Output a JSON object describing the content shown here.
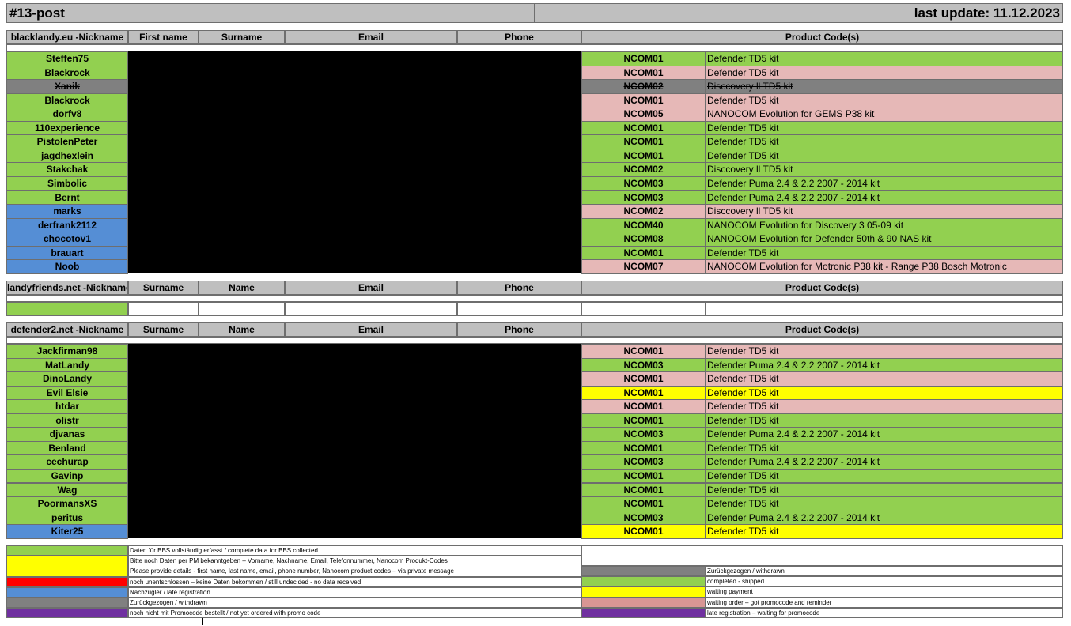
{
  "title_left": "#13-post",
  "title_right": "last update: 11.12.2023",
  "colors": {
    "green": "#92d050",
    "pink": "#e6b8b7",
    "gray": "#808080",
    "blue": "#558ed5",
    "yellow": "#ffff00",
    "red": "#ff0000",
    "purple": "#7030a0",
    "rose": "#d99694",
    "header": "#bfbfbf",
    "redacted": "#000000"
  },
  "sections": [
    {
      "headers": [
        "blacklandy.eu -Nickname",
        "First name",
        "Surname",
        "Email",
        "Phone",
        "Product Code(s)"
      ],
      "rows": [
        {
          "nick": "Steffen75",
          "nick_color": "green",
          "code": "NCOM01",
          "product": "Defender TD5 kit",
          "status_color": "green"
        },
        {
          "nick": "Blackrock",
          "nick_color": "green",
          "code": "NCOM01",
          "product": "Defender TD5 kit",
          "status_color": "pink"
        },
        {
          "nick": "Xanik",
          "nick_color": "gray",
          "code": "NCOM02",
          "product": "Disccovery ll TD5 kit",
          "status_color": "gray",
          "strike": true
        },
        {
          "nick": "Blackrock",
          "nick_color": "green",
          "code": "NCOM01",
          "product": "Defender TD5 kit",
          "status_color": "pink"
        },
        {
          "nick": "dorfv8",
          "nick_color": "green",
          "code": "NCOM05",
          "product": "NANOCOM Evolution for GEMS P38 kit",
          "status_color": "pink"
        },
        {
          "nick": "110experience",
          "nick_color": "green",
          "code": "NCOM01",
          "product": "Defender TD5 kit",
          "status_color": "green"
        },
        {
          "nick": "PistolenPeter",
          "nick_color": "green",
          "code": "NCOM01",
          "product": "Defender TD5 kit",
          "status_color": "green"
        },
        {
          "nick": "jagdhexlein",
          "nick_color": "green",
          "code": "NCOM01",
          "product": "Defender TD5 kit",
          "status_color": "green"
        },
        {
          "nick": "Stakchak",
          "nick_color": "green",
          "code": "NCOM02",
          "product": "Disccovery ll TD5 kit",
          "status_color": "green"
        },
        {
          "nick": "Simbolic",
          "nick_color": "green",
          "code": "NCOM03",
          "product": "Defender Puma 2.4 & 2.2 2007 - 2014 kit",
          "status_color": "green"
        },
        {
          "nick": "Bernt",
          "nick_color": "green",
          "code": "NCOM03",
          "product": "Defender Puma 2.4 & 2.2 2007 - 2014 kit",
          "status_color": "green"
        },
        {
          "nick": "marks",
          "nick_color": "blue",
          "code": "NCOM02",
          "product": "Disccovery ll TD5 kit",
          "status_color": "pink"
        },
        {
          "nick": "derfrank2112",
          "nick_color": "blue",
          "code": "NCOM40",
          "product": "NANOCOM Evolution for Discovery 3 05-09 kit",
          "status_color": "green"
        },
        {
          "nick": "chocotov1",
          "nick_color": "blue",
          "code": "NCOM08",
          "product": "NANOCOM Evolution for Defender 50th & 90 NAS kit",
          "status_color": "green"
        },
        {
          "nick": "brauart",
          "nick_color": "blue",
          "code": "NCOM01",
          "product": "Defender TD5 kit",
          "status_color": "green"
        },
        {
          "nick": "Noob",
          "nick_color": "blue",
          "code": "NCOM07",
          "product": "NANOCOM Evolution for Motronic P38 kit - Range P38 Bosch Motronic",
          "status_color": "pink"
        }
      ]
    },
    {
      "headers": [
        "landyfriends.net -Nickname",
        "Surname",
        "Name",
        "Email",
        "Phone",
        "Product Code(s)"
      ],
      "rows": []
    },
    {
      "headers": [
        "defender2.net -Nickname",
        "Surname",
        "Name",
        "Email",
        "Phone",
        "Product Code(s)"
      ],
      "rows": [
        {
          "nick": "Jackfirman98",
          "nick_color": "green",
          "code": "NCOM01",
          "product": "Defender TD5 kit",
          "status_color": "pink"
        },
        {
          "nick": "MatLandy",
          "nick_color": "green",
          "code": "NCOM03",
          "product": "Defender Puma 2.4 & 2.2 2007 - 2014 kit",
          "status_color": "green"
        },
        {
          "nick": "DinoLandy",
          "nick_color": "green",
          "code": "NCOM01",
          "product": "Defender TD5 kit",
          "status_color": "pink"
        },
        {
          "nick": "Evil Elsie",
          "nick_color": "green",
          "code": "NCOM01",
          "product": "Defender TD5 kit",
          "status_color": "yellow"
        },
        {
          "nick": "htdar",
          "nick_color": "green",
          "code": "NCOM01",
          "product": "Defender TD5 kit",
          "status_color": "pink"
        },
        {
          "nick": "olistr",
          "nick_color": "green",
          "code": "NCOM01",
          "product": "Defender TD5 kit",
          "status_color": "green"
        },
        {
          "nick": "djvanas",
          "nick_color": "green",
          "code": "NCOM03",
          "product": "Defender Puma 2.4 & 2.2 2007 - 2014 kit",
          "status_color": "green"
        },
        {
          "nick": "Benland",
          "nick_color": "green",
          "code": "NCOM01",
          "product": "Defender TD5 kit",
          "status_color": "green"
        },
        {
          "nick": "cechurap",
          "nick_color": "green",
          "code": "NCOM03",
          "product": "Defender Puma 2.4 & 2.2 2007 - 2014 kit",
          "status_color": "green"
        },
        {
          "nick": "Gavinp",
          "nick_color": "green",
          "code": "NCOM01",
          "product": "Defender TD5 kit",
          "status_color": "green"
        },
        {
          "nick": "Wag",
          "nick_color": "green",
          "code": "NCOM01",
          "product": "Defender TD5 kit",
          "status_color": "green"
        },
        {
          "nick": "PoormansXS",
          "nick_color": "green",
          "code": "NCOM01",
          "product": "Defender TD5 kit",
          "status_color": "green"
        },
        {
          "nick": "peritus",
          "nick_color": "green",
          "code": "NCOM03",
          "product": "Defender Puma 2.4 & 2.2 2007 - 2014 kit",
          "status_color": "green"
        },
        {
          "nick": "Kiter25",
          "nick_color": "blue",
          "code": "NCOM01",
          "product": "Defender TD5 kit",
          "status_color": "yellow"
        }
      ]
    }
  ],
  "legend_left": [
    {
      "color": "green",
      "text": "Daten für BBS vollständig erfasst / complete data for BBS collected"
    },
    {
      "color": "yellow",
      "text": "Bitte noch Daten per PM bekanntgeben – Vorname, Nachname, Email, Telefonnummer, Nanocom Produkt-Codes",
      "text2": "Please provide details - first name, last name, email, phone number, Nanocom product codes – via private message"
    },
    {
      "color": "red",
      "text": "noch unentschlossen – keine Daten bekommen / still undecided - no data received"
    },
    {
      "color": "blue",
      "text": "Nachzügler / late registration"
    },
    {
      "color": "gray",
      "text": "Zurückgezogen / withdrawn"
    },
    {
      "color": "purple",
      "text": "noch nicht mit Promocode bestellt / not yet ordered with promo code"
    }
  ],
  "legend_right": [
    {
      "color": "gray",
      "text": "Zurückgezogen / withdrawn"
    },
    {
      "color": "green",
      "text": "completed - shipped"
    },
    {
      "color": "yellow",
      "text": "waiting payment"
    },
    {
      "color": "rose",
      "text": "waiting order – got promocode and reminder"
    },
    {
      "color": "purple",
      "text": "late registration – waiting for promocode"
    }
  ]
}
